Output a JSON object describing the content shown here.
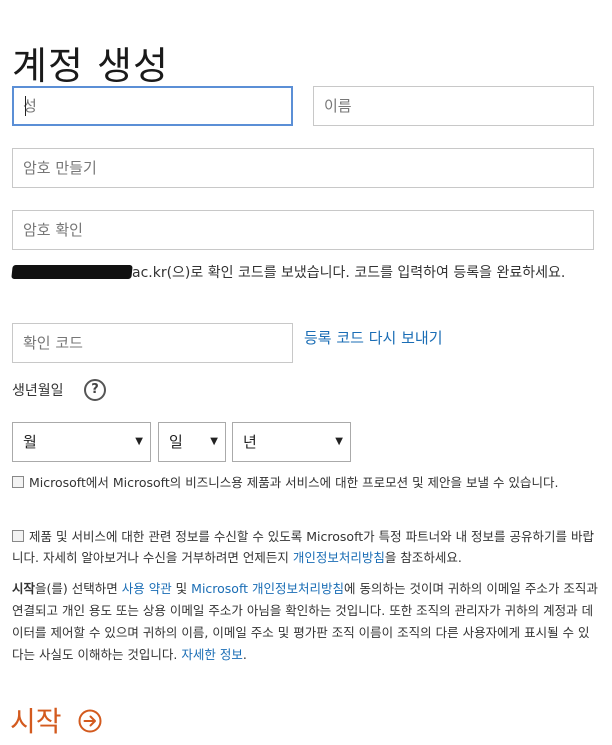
{
  "page_title": "계정 생성",
  "form": {
    "last_name_placeholder": "성",
    "first_name_placeholder": "이름",
    "password_placeholder": "암호 만들기",
    "confirm_password_placeholder": "암호 확인",
    "code_sent_email_suffix": "ac.kr",
    "code_sent_message": "(으)로 확인 코드를 보냈습니다. 코드를 입력하여 등록을 완료하세요.",
    "verification_code_placeholder": "확인 코드",
    "resend_code_link": "등록 코드 다시 보내기",
    "birthdate_label": "생년월일",
    "help_icon_glyph": "?",
    "month_select": "월",
    "day_select": "일",
    "year_select": "년"
  },
  "options": {
    "marketing_checkbox_label": "Microsoft에서 Microsoft의 비즈니스용 제품과 서비스에 대한 프로모션 및 제안을 보낼 수 있습니다.",
    "partner_checkbox_part1": "제품 및 서비스에 대한 관련 정보를 수신할 수 있도록 Microsoft가 특정 파트너와 내 정보를 공유하기를 바랍니다. 자세히 알아보거나 수신을 거부하려면 언제든지 ",
    "partner_checkbox_link": "개인정보처리방침",
    "partner_checkbox_part2": "을 참조하세요."
  },
  "terms": {
    "start_bold": "시작",
    "part1": "을(를) 선택하면 ",
    "terms_link": "사용 약관",
    "part2": " 및 ",
    "privacy_link": "Microsoft 개인정보처리방침",
    "part3": "에 동의하는 것이며 귀하의 이메일 주소가 조직과 연결되고 개인 용도 또는 상용 이메일 주소가 아님을 확인하는 것입니다. 또한 조직의 관리자가 귀하의 계정과 데이터를 제어할 수 있으며 귀하의 이름, 이메일 주소 및 평가판 조직 이름이 조직의 다른 사용자에게 표시될 수 있다는 사실도 이해하는 것입니다. ",
    "details_link": "자세한 정보",
    "part4": "."
  },
  "start_button_label": "시작",
  "colors": {
    "link": "#1a6db5",
    "accent": "#d35a1e",
    "focus_border": "#5b8fd6"
  },
  "icons": {
    "help": "question-circle-icon",
    "start": "arrow-circle-right-icon",
    "dropdown": "triangle-down-icon"
  }
}
